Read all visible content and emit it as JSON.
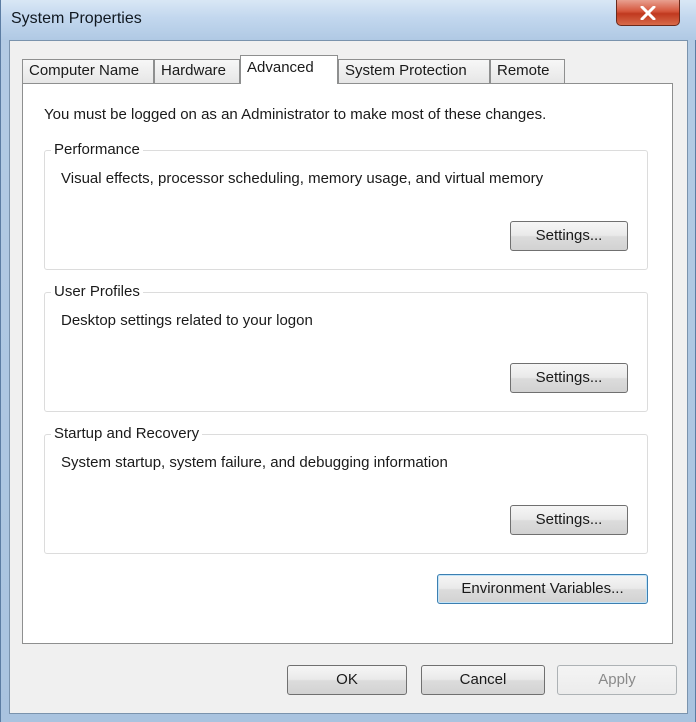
{
  "window": {
    "title": "System Properties",
    "close_glyph": "X"
  },
  "tabs": [
    {
      "label": "Computer Name",
      "active": false
    },
    {
      "label": "Hardware",
      "active": false
    },
    {
      "label": "Advanced",
      "active": true
    },
    {
      "label": "System Protection",
      "active": false
    },
    {
      "label": "Remote",
      "active": false
    }
  ],
  "advanced": {
    "notice": "You must be logged on as an Administrator to make most of these changes.",
    "performance": {
      "title": "Performance",
      "description": "Visual effects, processor scheduling, memory usage, and virtual memory",
      "button": "Settings..."
    },
    "user_profiles": {
      "title": "User Profiles",
      "description": "Desktop settings related to your logon",
      "button": "Settings..."
    },
    "startup_recovery": {
      "title": "Startup and Recovery",
      "description": "System startup, system failure, and debugging information",
      "button": "Settings..."
    },
    "environment_button": "Environment Variables..."
  },
  "footer": {
    "ok": "OK",
    "cancel": "Cancel",
    "apply": "Apply",
    "apply_enabled": false
  },
  "colors": {
    "title_bar": "#c2d7ee",
    "close_button": "#d5563c",
    "dialog_face": "#f0f0f0",
    "panel": "#ffffff",
    "focus_border": "#3c7fb1"
  }
}
